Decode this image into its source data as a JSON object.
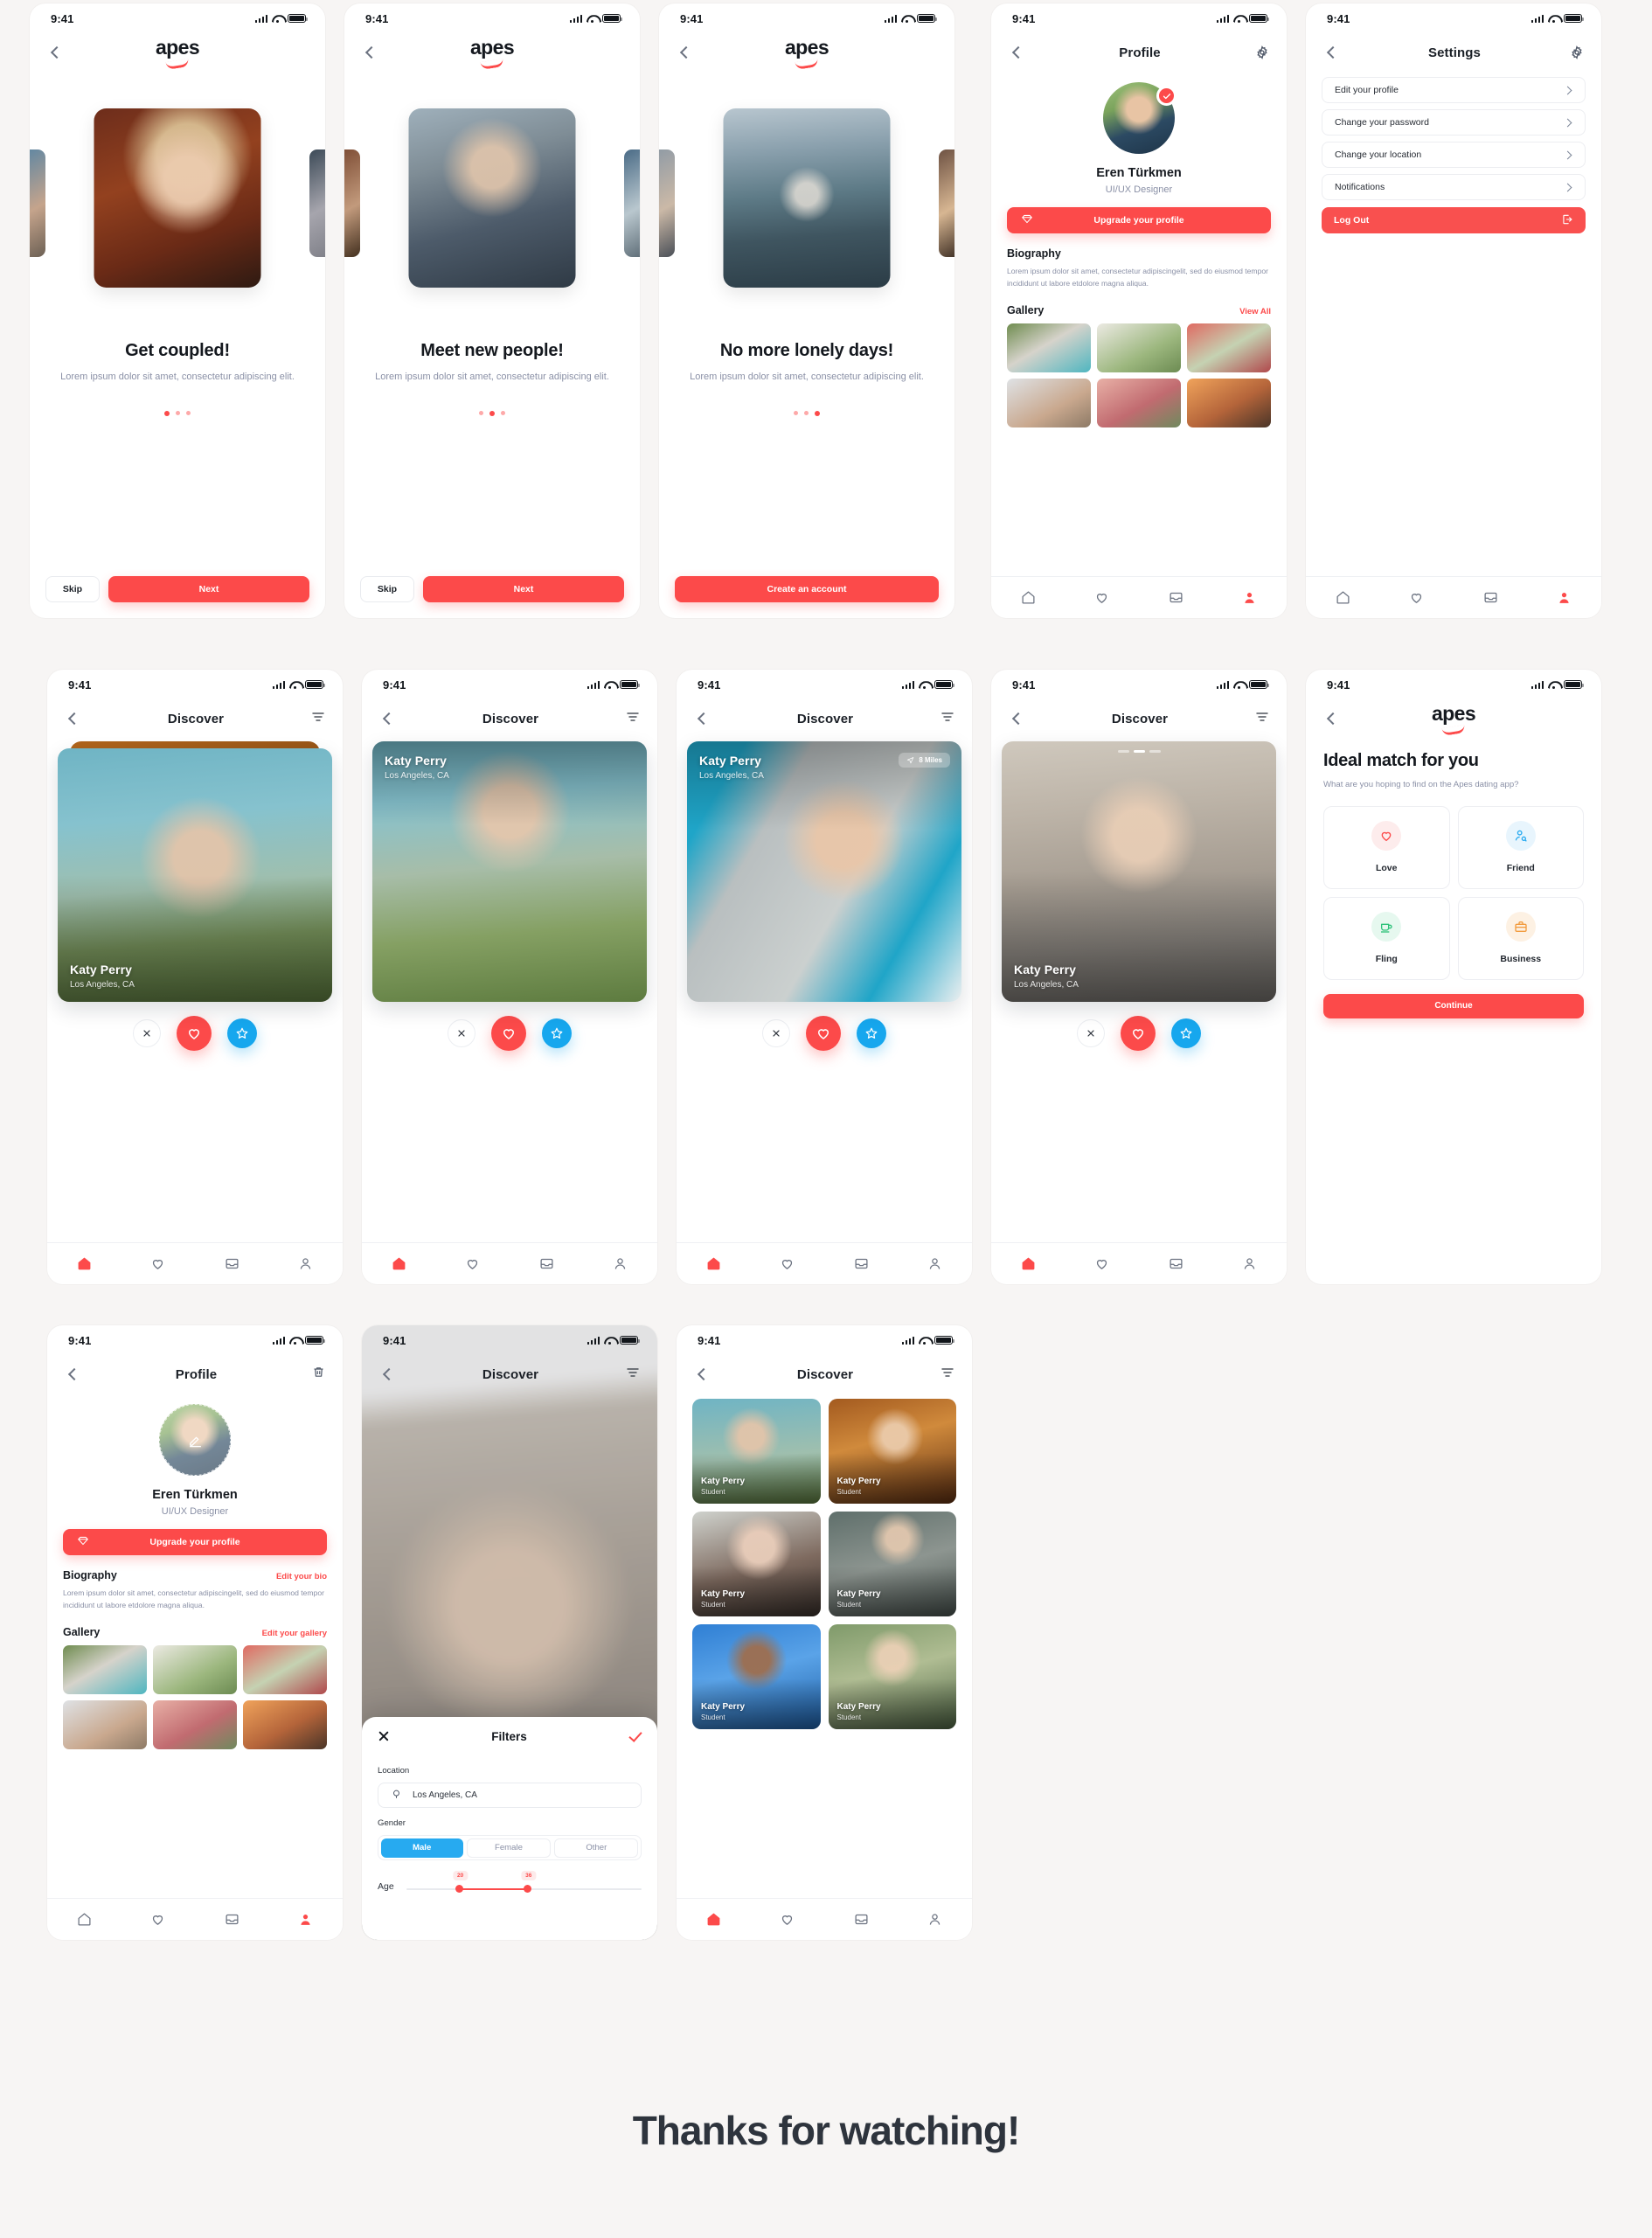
{
  "brand": {
    "name": "apes",
    "accent": "#fc4a4a",
    "blue": "#16a7ee",
    "dark": "#15191f",
    "muted": "#8a90a6"
  },
  "status_bar": {
    "time": "9:41"
  },
  "onboarding": [
    {
      "title": "Get coupled!",
      "subtitle": "Lorem ipsum dolor sit amet, consectetur adipiscing elit.",
      "active_dot": 0,
      "buttons": {
        "secondary": "Skip",
        "primary": "Next"
      }
    },
    {
      "title": "Meet new people!",
      "subtitle": "Lorem ipsum dolor sit amet, consectetur adipiscing elit.",
      "active_dot": 1,
      "buttons": {
        "secondary": "Skip",
        "primary": "Next"
      }
    },
    {
      "title": "No more lonely days!",
      "subtitle": "Lorem ipsum dolor sit amet, consectetur adipiscing elit.",
      "active_dot": 2,
      "buttons": {
        "secondary": "",
        "primary": "Create an account"
      }
    }
  ],
  "profile": {
    "nav_title": "Profile",
    "name": "Eren Türkmen",
    "role": "UI/UX Designer",
    "upgrade_label": "Upgrade your profile",
    "biography_title": "Biography",
    "biography_text": "Lorem ipsum dolor sit amet, consectetur adipiscingelit, sed do eiusmod tempor incididunt ut labore etdolore magna aliqua.",
    "gallery_title": "Gallery",
    "gallery_link": "View All",
    "gallery_count": 6
  },
  "profile_edit": {
    "nav_title": "Profile",
    "name": "Eren Türkmen",
    "role": "UI/UX Designer",
    "upgrade_label": "Upgrade your profile",
    "biography_title": "Biography",
    "biography_link": "Edit your bio",
    "biography_text": "Lorem ipsum dolor sit amet, consectetur adipiscingelit, sed do eiusmod tempor incididunt ut labore etdolore magna aliqua.",
    "gallery_title": "Gallery",
    "gallery_link": "Edit your gallery"
  },
  "settings": {
    "nav_title": "Settings",
    "items": [
      {
        "label": "Edit your profile"
      },
      {
        "label": "Change your password"
      },
      {
        "label": "Change your location"
      },
      {
        "label": "Notifications"
      }
    ],
    "logout_label": "Log Out"
  },
  "discover": {
    "nav_title": "Discover",
    "card": {
      "name": "Katy Perry",
      "location": "Los Angeles, CA",
      "distance": "8 Miles"
    },
    "pager": {
      "total": 3,
      "active": 1
    }
  },
  "discover_grid": {
    "nav_title": "Discover",
    "items": [
      {
        "name": "Katy Perry",
        "role": "Student"
      },
      {
        "name": "Katy Perry",
        "role": "Student"
      },
      {
        "name": "Katy Perry",
        "role": "Student"
      },
      {
        "name": "Katy Perry",
        "role": "Student"
      },
      {
        "name": "Katy Perry",
        "role": "Student"
      },
      {
        "name": "Katy Perry",
        "role": "Student"
      }
    ]
  },
  "ideal_match": {
    "title": "Ideal match for you",
    "subtitle": "What are you hoping to find on the Apes dating app?",
    "options": [
      {
        "label": "Love",
        "icon": "heart-icon",
        "color": "#fc4a4a",
        "bg": "#fdecec"
      },
      {
        "label": "Friend",
        "icon": "friend-icon",
        "color": "#27aaf0",
        "bg": "#e8f5fd"
      },
      {
        "label": "Fling",
        "icon": "coffee-icon",
        "color": "#2ec27a",
        "bg": "#e6f8ef"
      },
      {
        "label": "Business",
        "icon": "briefcase-icon",
        "color": "#f29b3d",
        "bg": "#fdf1e3"
      }
    ],
    "cta": "Continue"
  },
  "filters": {
    "title": "Filters",
    "location_label": "Location",
    "location_value": "Los Angeles, CA",
    "gender_label": "Gender",
    "gender_options": [
      "Male",
      "Female",
      "Other"
    ],
    "gender_selected": "Male",
    "age_label": "Age",
    "age_min": "20",
    "age_max": "36"
  },
  "footer": {
    "thanks": "Thanks for watching!"
  }
}
